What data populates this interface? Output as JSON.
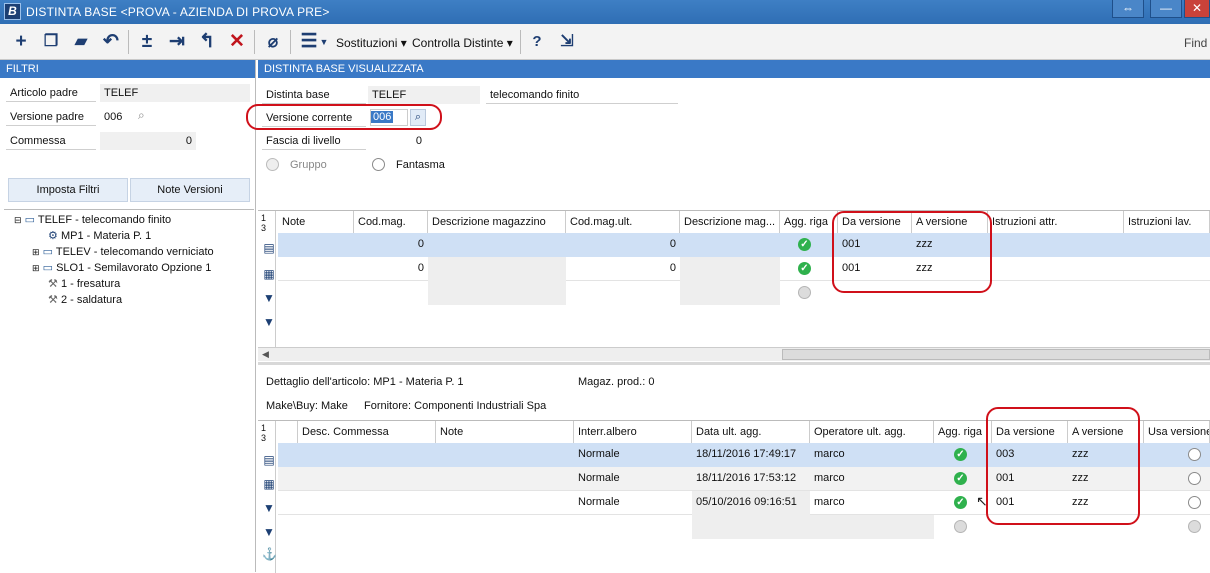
{
  "window": {
    "icon_letter": "B",
    "title": "DISTINTA BASE <PROVA - AZIENDA DI PROVA PRE>"
  },
  "toolbar": {
    "sostituzioni": "Sostituzioni",
    "controlla": "Controlla Distinte",
    "find": "Find"
  },
  "filters": {
    "header": "FILTRI",
    "articolo_label": "Articolo padre",
    "articolo_value": "TELEF",
    "versione_label": "Versione padre",
    "versione_value": "006",
    "commessa_label": "Commessa",
    "commessa_value": "0",
    "btn_filtri": "Imposta Filtri",
    "btn_note": "Note Versioni"
  },
  "tree": [
    {
      "label": "TELEF - telecomando finito"
    },
    {
      "label": "MP1 - Materia P. 1"
    },
    {
      "label": "TELEV - telecomando verniciato"
    },
    {
      "label": "SLO1 - Semilavorato Opzione 1"
    },
    {
      "label": "1 - fresatura"
    },
    {
      "label": "2 - saldatura"
    }
  ],
  "main": {
    "header": "DISTINTA BASE VISUALIZZATA",
    "distinta_label": "Distinta base",
    "distinta_value": "TELEF",
    "distinta_desc": "telecomando finito",
    "versione_label": "Versione corrente",
    "versione_value": "006",
    "fascia_label": "Fascia di livello",
    "fascia_value": "0",
    "gruppo": "Gruppo",
    "fantasma": "Fantasma"
  },
  "grid1": {
    "rownum": "1 3",
    "columns": [
      "Note",
      "Cod.mag.",
      "Descrizione magazzino",
      "Cod.mag.ult.",
      "Descrizione mag...",
      "Agg. riga",
      "Da versione",
      "A versione",
      "Istruzioni attr.",
      "Istruzioni lav."
    ],
    "rows": [
      {
        "codmag": "0",
        "codult": "0",
        "da": "001",
        "a": "zzz"
      },
      {
        "codmag": "0",
        "codult": "0",
        "da": "001",
        "a": "zzz"
      }
    ]
  },
  "detail": {
    "articolo": "Dettaglio dell'articolo: MP1 - Materia P. 1",
    "magaz": "Magaz. prod.: 0",
    "make": "Make\\Buy: Make",
    "fornitore": "Fornitore: Componenti Industriali Spa"
  },
  "grid2": {
    "rownum": "1 3",
    "columns": [
      "Desc. Commessa",
      "Note",
      "Interr.albero",
      "Data ult. agg.",
      "Operatore ult. agg.",
      "Agg. riga",
      "Da versione",
      "A versione",
      "Usa versione"
    ],
    "rows": [
      {
        "interr": "Normale",
        "data": "18/11/2016 17:49:17",
        "op": "marco",
        "da": "003",
        "a": "zzz"
      },
      {
        "interr": "Normale",
        "data": "18/11/2016 17:53:12",
        "op": "marco",
        "da": "001",
        "a": "zzz"
      },
      {
        "interr": "Normale",
        "data": "05/10/2016 09:16:51",
        "op": "marco",
        "da": "001",
        "a": "zzz"
      }
    ]
  },
  "colors": {
    "title": "#2f6eb4",
    "pane_header": "#3a79c6",
    "selected_row": "#cfe0f5",
    "annotation": "#d0101a"
  }
}
